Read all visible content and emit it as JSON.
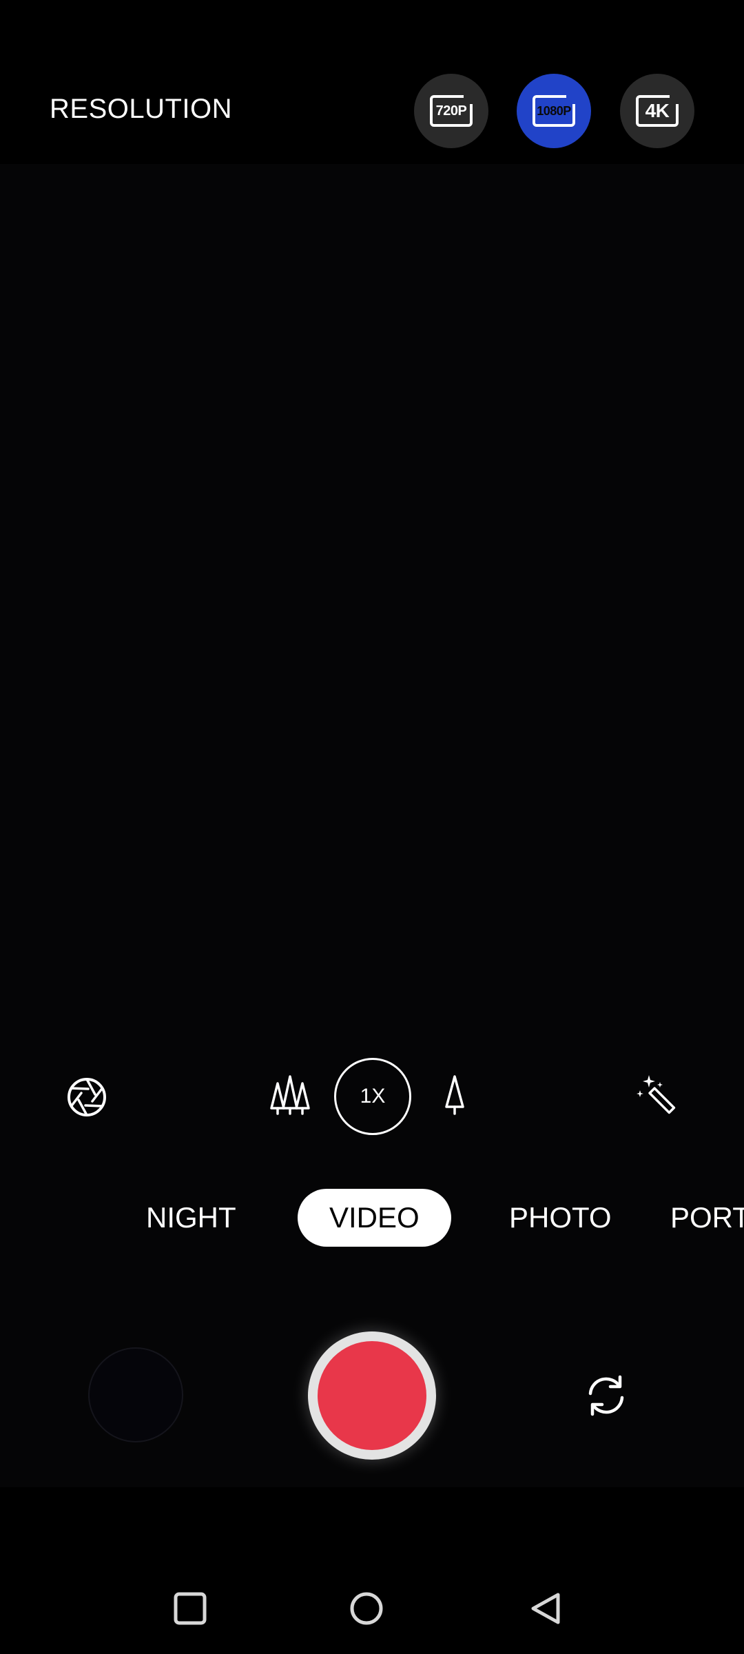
{
  "top_bar": {
    "title": "RESOLUTION",
    "options": [
      {
        "label": "720P",
        "selected": false
      },
      {
        "label": "1080P",
        "selected": true
      },
      {
        "label": "4K",
        "selected": false
      }
    ],
    "selected_color": "#2143c8"
  },
  "tools": {
    "left_icon": "aperture-icon",
    "wide_lens_icon": "trees-icon",
    "zoom_label": "1X",
    "tele_lens_icon": "tree-icon",
    "right_icon": "magic-wand-icon"
  },
  "modes": [
    {
      "label": "NIGHT",
      "active": false
    },
    {
      "label": "VIDEO",
      "active": true
    },
    {
      "label": "PHOTO",
      "active": false
    },
    {
      "label": "PORT",
      "active": false
    }
  ],
  "controls": {
    "record_color": "#e8374a",
    "switch_camera_icon": "camera-switch-icon",
    "gallery_icon": "gallery-thumbnail"
  },
  "nav": {
    "recents_icon": "square-icon",
    "home_icon": "circle-icon",
    "back_icon": "triangle-back-icon"
  }
}
